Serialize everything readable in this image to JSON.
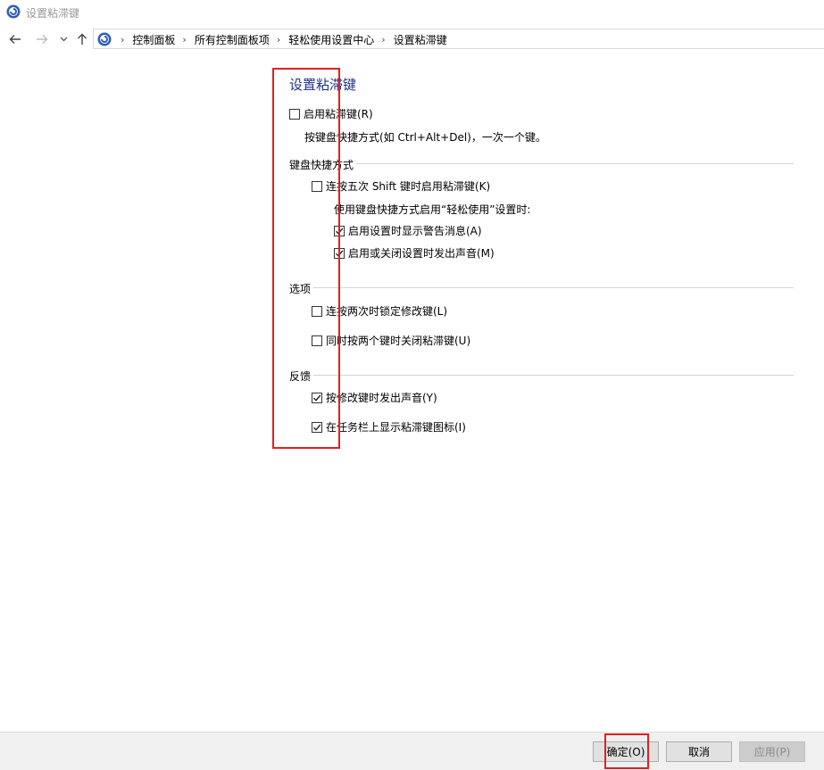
{
  "window": {
    "title": "设置粘滞键"
  },
  "breadcrumb": [
    "控制面板",
    "所有控制面板项",
    "轻松使用设置中心",
    "设置粘滞键"
  ],
  "page": {
    "heading": "设置粘滞键",
    "enable": {
      "label": "启用粘滞键(R)",
      "checked": false
    },
    "enable_desc": "按键盘快捷方式(如 Ctrl+Alt+Del)，一次一个键。",
    "shortcut_section": {
      "title": "键盘快捷方式",
      "shift_five": {
        "label": "连按五次 Shift 键时启用粘滞键(K)",
        "checked": false
      },
      "sub_desc": "使用键盘快捷方式启用“轻松使用”设置时:",
      "show_warning": {
        "label": "启用设置时显示警告消息(A)",
        "checked": true
      },
      "play_sound": {
        "label": "启用或关闭设置时发出声音(M)",
        "checked": true
      }
    },
    "options_section": {
      "title": "选项",
      "lock_modifier": {
        "label": "连按两次时锁定修改键(L)",
        "checked": false
      },
      "turn_off_two_keys": {
        "label": "同时按两个键时关闭粘滞键(U)",
        "checked": false
      }
    },
    "feedback_section": {
      "title": "反馈",
      "sound_on_modifier": {
        "label": "按修改键时发出声音(Y)",
        "checked": true
      },
      "taskbar_icon": {
        "label": "在任务栏上显示粘滞键图标(I)",
        "checked": true
      }
    }
  },
  "buttons": {
    "ok": "确定(O)",
    "cancel": "取消",
    "apply": "应用(P)"
  },
  "colors": {
    "heading": "#1e3287",
    "highlight": "#e02020"
  }
}
